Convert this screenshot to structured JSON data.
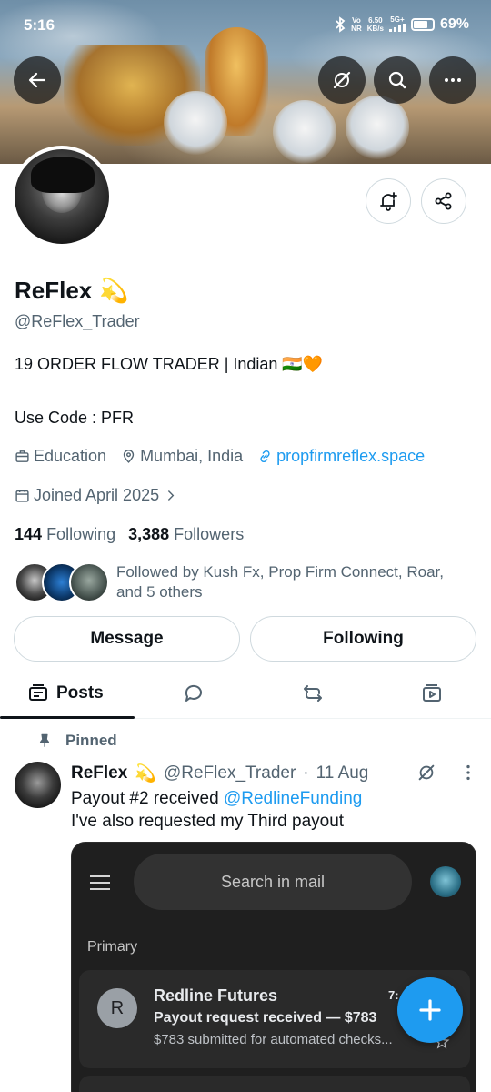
{
  "status_bar": {
    "time": "5:16",
    "network_top": "Vo",
    "network_bottom": "NR",
    "speed_value": "6.50",
    "speed_unit": "KB/s",
    "signal_type": "5G+",
    "battery": "69%"
  },
  "nav": {
    "back_icon": "arrow-left-icon",
    "grok_icon": "grok-icon",
    "search_icon": "search-icon",
    "more_icon": "more-icon"
  },
  "actions": {
    "notify_icon": "bell-plus-icon",
    "share_icon": "share-icon"
  },
  "profile": {
    "name": "ReFlex",
    "name_emoji": "💫",
    "handle": "@ReFlex_Trader",
    "bio": "19 ORDER FLOW TRADER | Indian 🇮🇳🧡",
    "code": "Use Code : PFR",
    "category": "Education",
    "location": "Mumbai, India",
    "website": "propfirmreflex.space",
    "joined": "Joined April 2025",
    "following_count": "144",
    "following_label": "Following",
    "followers_count": "3,388",
    "followers_label": "Followers",
    "followed_by": "Followed by Kush Fx, Prop Firm Connect, Roar, and 5 others"
  },
  "buttons": {
    "message": "Message",
    "following": "Following"
  },
  "tabs": [
    {
      "label": "Posts",
      "icon": "posts-icon",
      "active": true
    },
    {
      "label": "",
      "icon": "replies-icon",
      "active": false
    },
    {
      "label": "",
      "icon": "repost-icon",
      "active": false
    },
    {
      "label": "",
      "icon": "media-icon",
      "active": false
    }
  ],
  "post": {
    "pinned_label": "Pinned",
    "author": "ReFlex",
    "author_emoji": "💫",
    "handle": "@ReFlex_Trader",
    "separator": "·",
    "date": "11 Aug",
    "line1_prefix": "Payout #2 received ",
    "mention": "@RedlineFunding",
    "line2": "I've also requested my Third payout"
  },
  "media": {
    "search_placeholder": "Search in mail",
    "section": "Primary",
    "email": {
      "avatar_letter": "R",
      "from": "Redline Futures",
      "time": "7:",
      "subject": "Payout request received — $783",
      "snippet": "$783 submitted for automated checks..."
    }
  },
  "colors": {
    "accent": "#1d9bf0",
    "secondary_text": "#536471",
    "border": "#cfd9de",
    "mail_bg": "#1f1f1f"
  }
}
